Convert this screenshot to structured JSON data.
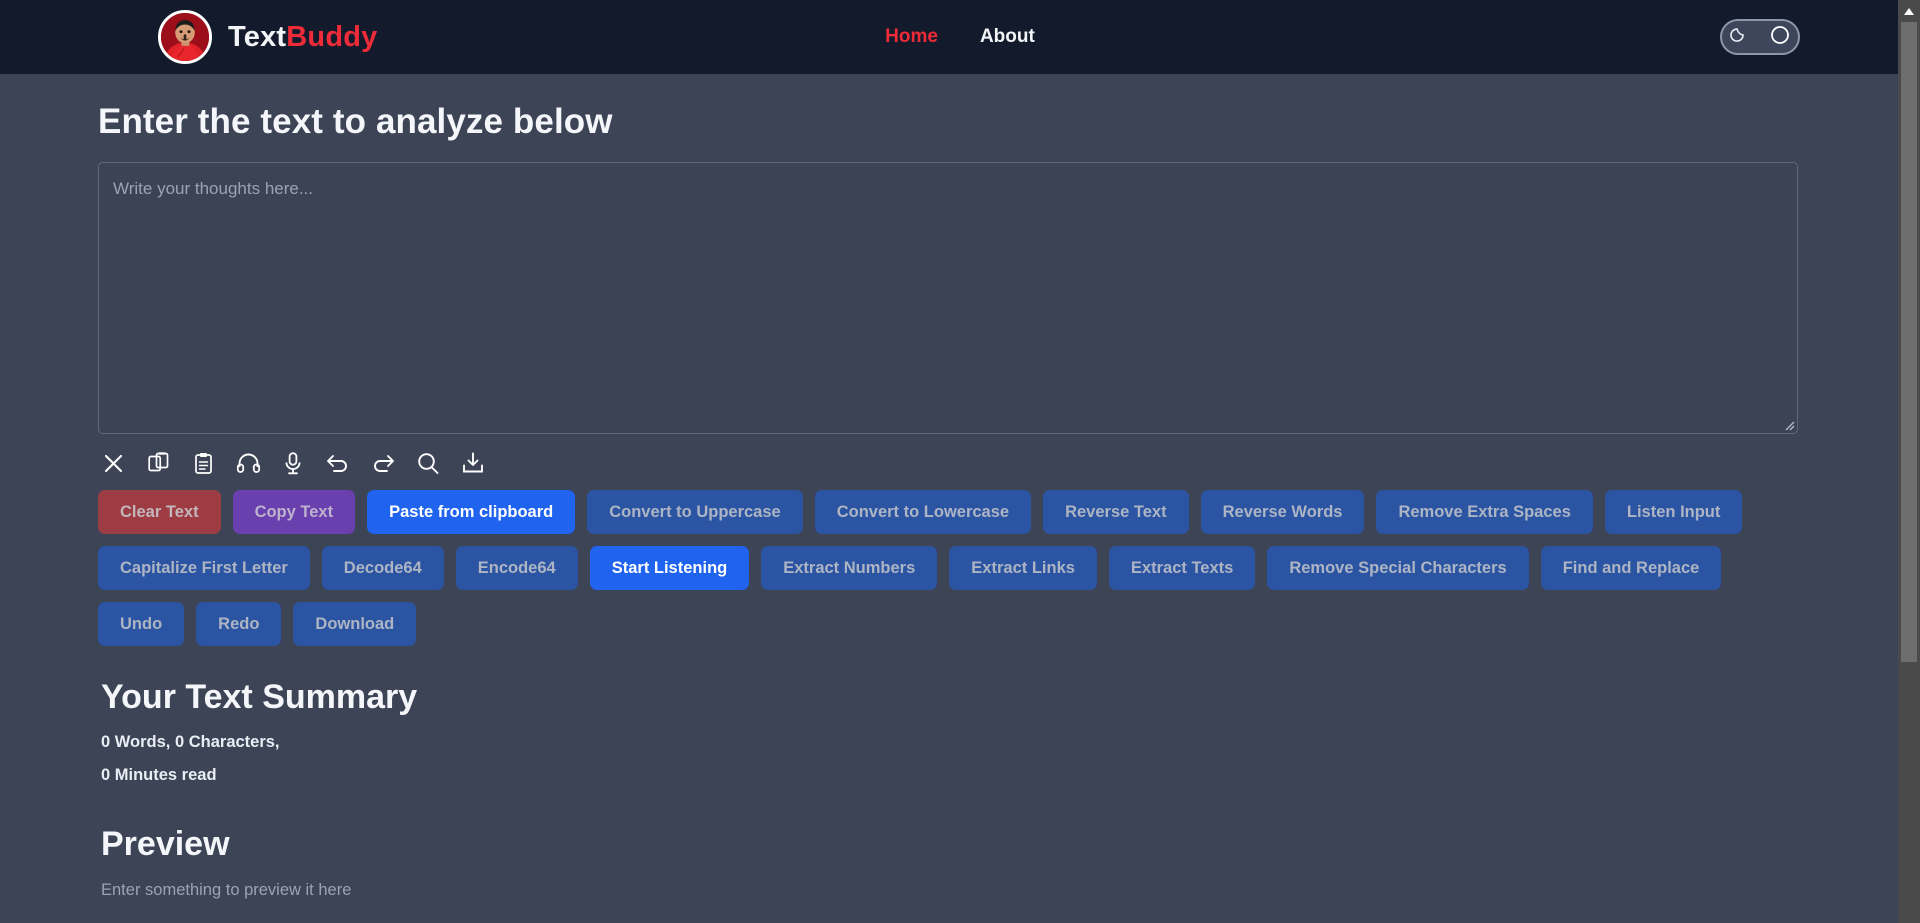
{
  "navbar": {
    "brand": {
      "text_primary": "Text",
      "text_accent": "Buddy",
      "avatar_icon": "user-avatar-icon",
      "accent_color": "#ee2b38"
    },
    "links": [
      {
        "label": "Home",
        "state": "active"
      },
      {
        "label": "About",
        "state": "inactive"
      }
    ],
    "theme_toggle": {
      "moon_icon": "moon-icon",
      "knob_icon": "circle-knob-icon",
      "state": "dark"
    },
    "background_color": "#131a2b"
  },
  "main": {
    "heading": "Enter the text to analyze below",
    "textarea": {
      "value": "",
      "placeholder": "Write your thoughts here...",
      "resize_handle_icon": "resize-grip-icon"
    },
    "icon_toolbar": [
      {
        "name": "close-icon",
        "title": "Clear"
      },
      {
        "name": "copy-icon",
        "title": "Copy"
      },
      {
        "name": "clipboard-icon",
        "title": "Paste"
      },
      {
        "name": "headphones-icon",
        "title": "Listen"
      },
      {
        "name": "microphone-icon",
        "title": "Speak"
      },
      {
        "name": "undo-icon",
        "title": "Undo"
      },
      {
        "name": "redo-icon",
        "title": "Redo"
      },
      {
        "name": "search-icon",
        "title": "Find"
      },
      {
        "name": "download-icon",
        "title": "Download"
      }
    ],
    "button_rows": [
      [
        {
          "label": "Clear Text",
          "style": "muted-red"
        },
        {
          "label": "Copy Text",
          "style": "muted-purple"
        },
        {
          "label": "Paste from clipboard",
          "style": "active-blue"
        },
        {
          "label": "Convert to Uppercase",
          "style": "muted-blue"
        },
        {
          "label": "Convert to Lowercase",
          "style": "muted-blue"
        },
        {
          "label": "Reverse Text",
          "style": "muted-blue"
        },
        {
          "label": "Reverse Words",
          "style": "muted-blue"
        },
        {
          "label": "Remove Extra Spaces",
          "style": "muted-blue"
        },
        {
          "label": "Listen Input",
          "style": "muted-blue"
        }
      ],
      [
        {
          "label": "Capitalize First Letter",
          "style": "muted-blue"
        },
        {
          "label": "Decode64",
          "style": "muted-blue"
        },
        {
          "label": "Encode64",
          "style": "muted-blue"
        },
        {
          "label": "Start Listening",
          "style": "active-blue"
        },
        {
          "label": "Extract Numbers",
          "style": "muted-blue"
        },
        {
          "label": "Extract Links",
          "style": "muted-blue"
        },
        {
          "label": "Extract Texts",
          "style": "muted-blue"
        },
        {
          "label": "Remove Special Characters",
          "style": "muted-blue"
        },
        {
          "label": "Find and Replace",
          "style": "muted-blue"
        }
      ],
      [
        {
          "label": "Undo",
          "style": "muted-blue"
        },
        {
          "label": "Redo",
          "style": "muted-blue"
        },
        {
          "label": "Download",
          "style": "muted-blue"
        }
      ]
    ],
    "summary": {
      "title": "Your Text Summary",
      "counts_line": "0 Words, 0 Characters,",
      "read_time_line": "0 Minutes read"
    },
    "preview": {
      "title": "Preview",
      "empty_text": "Enter something to preview it here"
    }
  },
  "scrollbar": {
    "up_arrow_icon": "scroll-up-arrow-icon"
  }
}
